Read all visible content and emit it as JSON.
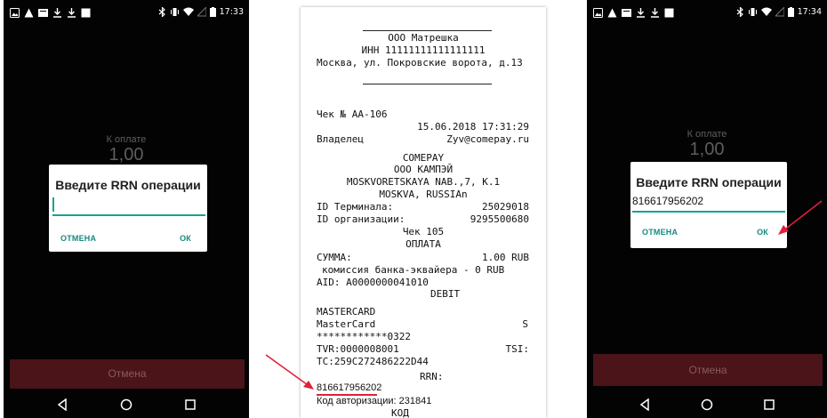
{
  "left_phone": {
    "status_time": "17:33",
    "amount_label": "К оплате",
    "amount_value": "1,00",
    "dialog": {
      "title": "Введите RRN операции",
      "input_value": "",
      "cancel_label": "ОТМЕНА",
      "ok_label": "ОК"
    },
    "cancel_bar_label": "Отмена"
  },
  "receipt": {
    "company": "ООО Матрешка",
    "inn": "ИНН 11111111111111111",
    "address": "Москва, ул. Покровские ворота, д.13",
    "check_no": "Чек № АА-106",
    "datetime": "15.06.2018 17:31:29",
    "owner_label": "Владелец",
    "owner_email": "Zyv@comepay.ru",
    "bank_brand": "COMEPAY",
    "bank_company": "ООО КАМПЭЙ",
    "bank_address1": "MOSKVORETSKAYA NAB.,7, K.1",
    "bank_address2": "MOSKVA, RUSSIAn",
    "terminal_label": "ID Терминала:",
    "terminal_value": "25029018",
    "org_label": "ID организации:",
    "org_value": "9295500680",
    "check_line": "Чек 105",
    "payment": "ОПЛАТА",
    "sum_label": "СУММА:",
    "sum_value": "1.00 RUB",
    "fee": "комиссия банка-эквайера - 0 RUB",
    "aid": "AID: A0000000041010",
    "debit": "DEBIT",
    "card_type": "MASTERCARD",
    "card_name": "MasterCard",
    "card_flag": "S",
    "pan": "************0322",
    "tvr": "TVR:0000008001",
    "tsi": "TSI:",
    "tc": "TC:259C272486222D44",
    "rrn_label": "RRN:",
    "rrn_value": "816617956202",
    "auth_code": "Код авторизации: 231841",
    "code_label": "КОД"
  },
  "right_phone": {
    "status_time": "17:34",
    "amount_label": "К оплате",
    "amount_value": "1,00",
    "dialog": {
      "title": "Введите RRN операции",
      "input_value": "816617956202",
      "cancel_label": "ОТМЕНА",
      "ok_label": "ОК"
    },
    "cancel_bar_label": "Отмена"
  },
  "colors": {
    "accent": "#16a393",
    "cancel_bar": "#4a1418",
    "arrow": "#e0203a"
  }
}
